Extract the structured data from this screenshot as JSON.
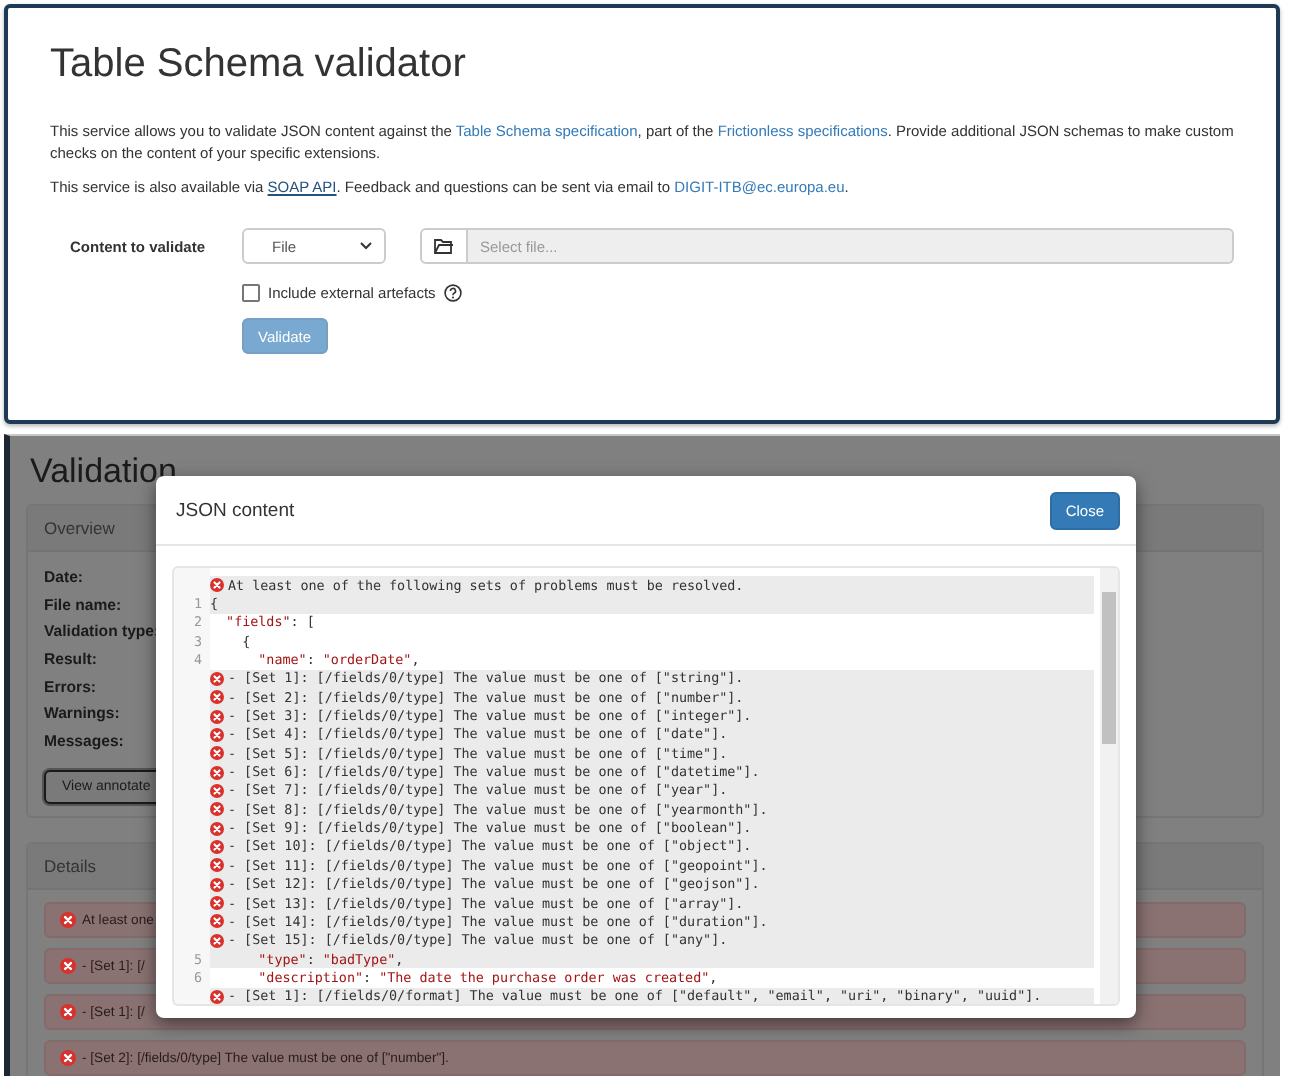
{
  "header": {
    "title": "Table Schema validator",
    "paragraphs": [
      [
        {
          "kind": "text",
          "text": "This service allows you to validate JSON content against the "
        },
        {
          "kind": "link",
          "text": "Table Schema specification"
        },
        {
          "kind": "text",
          "text": ", part of the "
        },
        {
          "kind": "link",
          "text": "Frictionless specifications"
        },
        {
          "kind": "text",
          "text": ". Provide additional JSON schemas to make custom checks on the content of your specific extensions."
        }
      ],
      [
        {
          "kind": "text",
          "text": "This service is also available via "
        },
        {
          "kind": "underlined",
          "text": "SOAP API"
        },
        {
          "kind": "text",
          "text": ". Feedback and questions can be sent via email to "
        },
        {
          "kind": "link",
          "text": "DIGIT-ITB@ec.europa.eu"
        },
        {
          "kind": "text",
          "text": "."
        }
      ]
    ]
  },
  "form": {
    "content_label": "Content to validate",
    "source_select": {
      "value": "File"
    },
    "file_field": {
      "placeholder": "Select file..."
    },
    "include_external": {
      "label": "Include external artefacts",
      "checked": false
    },
    "validate_button": {
      "label": "Validate",
      "disabled": true
    }
  },
  "result": {
    "title": "Validation",
    "overview": {
      "title": "Overview",
      "labels": [
        "Date:",
        "File name:",
        "Validation type:",
        "Result:",
        "Errors:",
        "Warnings:",
        "Messages:"
      ],
      "view_button": {
        "label": "View annotate"
      }
    },
    "details": {
      "title": "Details",
      "alerts": [
        "At least one",
        "- [Set 1]: [/",
        "- [Set 1]: [/",
        "- [Set 2]: [/fields/0/type] The value must be one of [\"number\"]."
      ]
    }
  },
  "modal": {
    "title": "JSON content",
    "close_button": "Close",
    "code_rows": [
      {
        "kind": "error",
        "text": "At least one of the following sets of problems must be resolved."
      },
      {
        "kind": "code",
        "number": "1",
        "highlighted": true,
        "tokens": [
          {
            "kind": "plain",
            "text": "{"
          }
        ]
      },
      {
        "kind": "code",
        "number": "2",
        "highlighted": false,
        "tokens": [
          {
            "kind": "string",
            "text": "  \"fields\""
          },
          {
            "kind": "plain",
            "text": ": ["
          }
        ]
      },
      {
        "kind": "code",
        "number": "3",
        "highlighted": false,
        "tokens": [
          {
            "kind": "plain",
            "text": "    {"
          }
        ]
      },
      {
        "kind": "code",
        "number": "4",
        "highlighted": false,
        "tokens": [
          {
            "kind": "string",
            "text": "      \"name\""
          },
          {
            "kind": "plain",
            "text": ": "
          },
          {
            "kind": "string",
            "text": "\"orderDate\""
          },
          {
            "kind": "plain",
            "text": ","
          }
        ]
      },
      {
        "kind": "error",
        "text": "- [Set 1]: [/fields/0/type] The value must be one of [\"string\"]."
      },
      {
        "kind": "error",
        "text": "- [Set 2]: [/fields/0/type] The value must be one of [\"number\"]."
      },
      {
        "kind": "error",
        "text": "- [Set 3]: [/fields/0/type] The value must be one of [\"integer\"]."
      },
      {
        "kind": "error",
        "text": "- [Set 4]: [/fields/0/type] The value must be one of [\"date\"]."
      },
      {
        "kind": "error",
        "text": "- [Set 5]: [/fields/0/type] The value must be one of [\"time\"]."
      },
      {
        "kind": "error",
        "text": "- [Set 6]: [/fields/0/type] The value must be one of [\"datetime\"]."
      },
      {
        "kind": "error",
        "text": "- [Set 7]: [/fields/0/type] The value must be one of [\"year\"]."
      },
      {
        "kind": "error",
        "text": "- [Set 8]: [/fields/0/type] The value must be one of [\"yearmonth\"]."
      },
      {
        "kind": "error",
        "text": "- [Set 9]: [/fields/0/type] The value must be one of [\"boolean\"]."
      },
      {
        "kind": "error",
        "text": "- [Set 10]: [/fields/0/type] The value must be one of [\"object\"]."
      },
      {
        "kind": "error",
        "text": "- [Set 11]: [/fields/0/type] The value must be one of [\"geopoint\"]."
      },
      {
        "kind": "error",
        "text": "- [Set 12]: [/fields/0/type] The value must be one of [\"geojson\"]."
      },
      {
        "kind": "error",
        "text": "- [Set 13]: [/fields/0/type] The value must be one of [\"array\"]."
      },
      {
        "kind": "error",
        "text": "- [Set 14]: [/fields/0/type] The value must be one of [\"duration\"]."
      },
      {
        "kind": "error",
        "text": "- [Set 15]: [/fields/0/type] The value must be one of [\"any\"]."
      },
      {
        "kind": "code",
        "number": "5",
        "highlighted": true,
        "tokens": [
          {
            "kind": "string",
            "text": "      \"type\""
          },
          {
            "kind": "plain",
            "text": ": "
          },
          {
            "kind": "string",
            "text": "\"badType\""
          },
          {
            "kind": "plain",
            "text": ","
          }
        ]
      },
      {
        "kind": "code",
        "number": "6",
        "highlighted": false,
        "tokens": [
          {
            "kind": "string",
            "text": "      \"description\""
          },
          {
            "kind": "plain",
            "text": ": "
          },
          {
            "kind": "string",
            "text": "\"The date the purchase order was created\""
          },
          {
            "kind": "plain",
            "text": ","
          }
        ]
      },
      {
        "kind": "error",
        "text": "- [Set 1]: [/fields/0/format] The value must be one of [\"default\", \"email\", \"uri\", \"binary\", \"uuid\"]."
      }
    ]
  }
}
